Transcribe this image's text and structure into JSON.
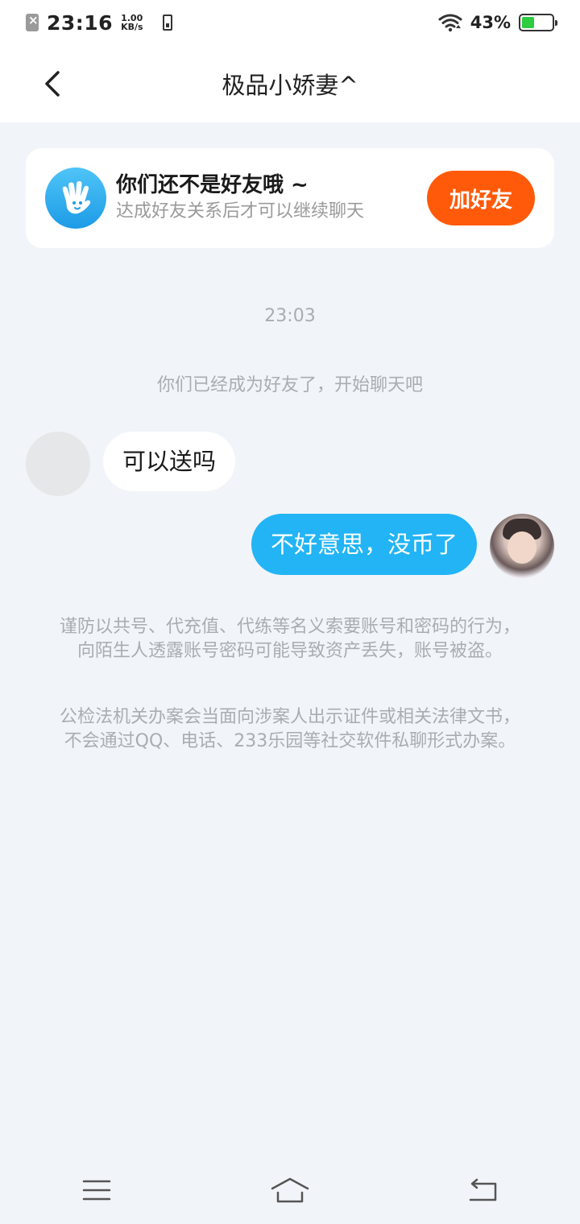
{
  "status_bar": {
    "time": "23:16",
    "speed_value": "1.00",
    "speed_unit": "KB/s",
    "battery_percent": "43%",
    "battery_level": 0.43,
    "battery_color": "#2ecc40"
  },
  "header": {
    "title": "极品小娇妻^",
    "back_icon": "chevron-left-icon"
  },
  "friend_banner": {
    "icon": "waving-hand-icon",
    "title": "你们还不是好友哦 ~",
    "subtitle": "达成好友关系后才可以继续聊天",
    "button_label": "加好友",
    "button_color": "#ff5a0a"
  },
  "chat": {
    "timestamp": "23:03",
    "system_message": "你们已经成为好友了，开始聊天吧",
    "messages": [
      {
        "side": "left",
        "text": "可以送吗"
      },
      {
        "side": "right",
        "text": "不好意思，没币了"
      }
    ],
    "outgoing_bubble_color": "#22b4f5"
  },
  "warnings": [
    "谨防以共号、代充值、代练等名义索要账号和密码的行为，向陌生人透露账号密码可能导致资产丢失，账号被盗。",
    "公检法机关办案会当面向涉案人出示证件或相关法律文书，不会通过QQ、电话、233乐园等社交软件私聊形式办案。"
  ],
  "nav_bar": {
    "buttons": [
      "menu-icon",
      "home-icon",
      "back-icon"
    ]
  }
}
